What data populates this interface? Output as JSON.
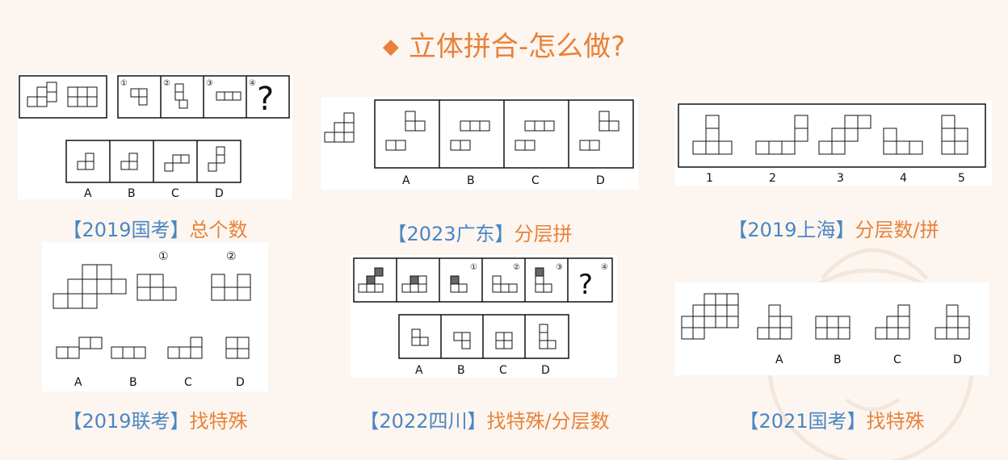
{
  "title": "立体拼合-怎么做?",
  "title_marker": "◆",
  "cards": [
    {
      "year": "【2019国考】",
      "kind": "总个数",
      "options": [
        "A",
        "B",
        "C",
        "D"
      ],
      "numbers": [
        "①",
        "②",
        "③",
        "④"
      ],
      "question": "?"
    },
    {
      "year": "【2023广东】",
      "kind": "分层拼",
      "options": [
        "A",
        "B",
        "C",
        "D"
      ]
    },
    {
      "year": "【2019上海】",
      "kind": "分层数/拼",
      "numbers": [
        "1",
        "2",
        "3",
        "4",
        "5"
      ]
    },
    {
      "year": "【2019联考】",
      "kind": "找特殊",
      "options": [
        "A",
        "B",
        "C",
        "D"
      ],
      "numbers": [
        "①",
        "②"
      ]
    },
    {
      "year": "【2022四川】",
      "kind": "找特殊/分层数",
      "options": [
        "A",
        "B",
        "C",
        "D"
      ],
      "numbers": [
        "①",
        "②",
        "③",
        "④"
      ],
      "question": "?"
    },
    {
      "year": "【2021国考】",
      "kind": "找特殊",
      "options": [
        "A",
        "B",
        "C",
        "D"
      ]
    }
  ],
  "colors": {
    "accent": "#E8823A",
    "year": "#4A86C5",
    "background": "#FDF6F0"
  }
}
